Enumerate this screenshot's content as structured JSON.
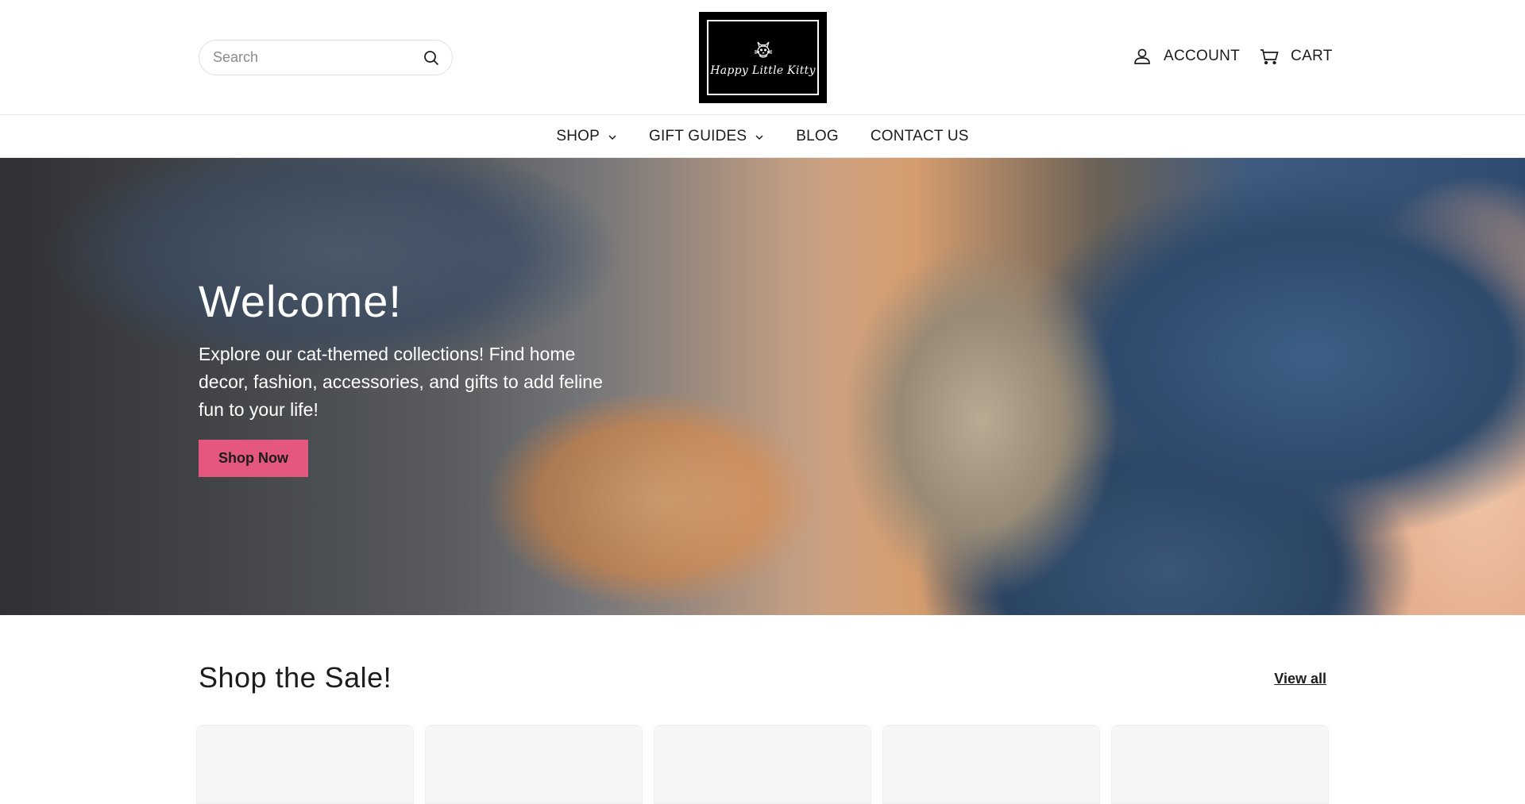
{
  "header": {
    "search": {
      "placeholder": "Search",
      "icon": "search-icon"
    },
    "logo": {
      "text": "Happy Little Kitty",
      "icon": "cat-icon"
    },
    "account_label": "ACCOUNT",
    "cart_label": "CART"
  },
  "nav": {
    "items": [
      {
        "label": "SHOP",
        "has_dropdown": true
      },
      {
        "label": "GIFT GUIDES",
        "has_dropdown": true
      },
      {
        "label": "BLOG",
        "has_dropdown": false
      },
      {
        "label": "CONTACT US",
        "has_dropdown": false
      }
    ]
  },
  "hero": {
    "title": "Welcome!",
    "text": "Explore our cat-themed collections! Find home decor, fashion, accessories, and gifts to add feline fun to your life!",
    "button_label": "Shop Now",
    "button_color": "#e4577e"
  },
  "sale": {
    "title": "Shop the Sale!",
    "view_all_label": "View all",
    "card_count": 5
  }
}
